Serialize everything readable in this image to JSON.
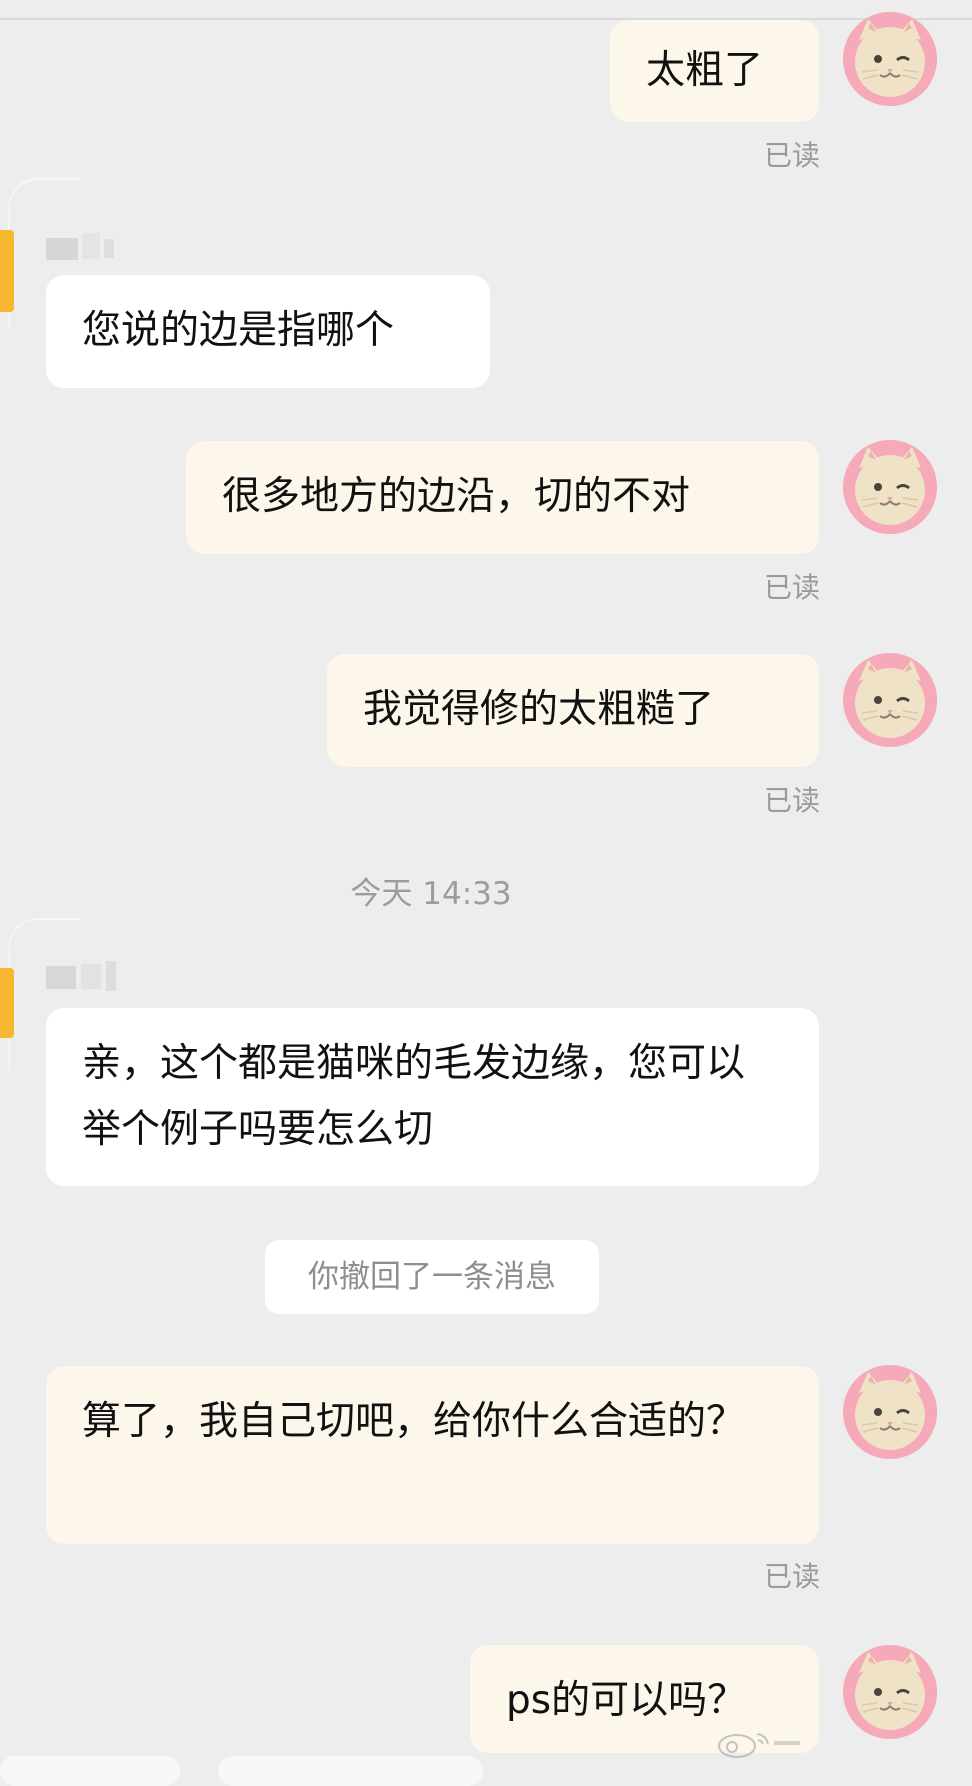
{
  "chat": {
    "messages": [
      {
        "id": "m1",
        "text": "太粗了",
        "status": "已读"
      },
      {
        "id": "m2",
        "text": "您说的边是指哪个"
      },
      {
        "id": "m3",
        "text": "很多地方的边沿，切的不对",
        "status": "已读"
      },
      {
        "id": "m4",
        "text": "我觉得修的太粗糙了",
        "status": "已读"
      },
      {
        "id": "m5",
        "text": "亲，这个都是猫咪的毛发边缘，您可以举个例子吗要怎么切"
      },
      {
        "id": "m6",
        "text": "算了，我自己切吧，给你什么合适的？",
        "status": "已读"
      },
      {
        "id": "m7",
        "text": "ps的可以吗？"
      }
    ],
    "timestamp": "今天 14:33",
    "system_notice": "你撤回了一条消息"
  },
  "colors": {
    "background": "#ededed",
    "outgoing_bubble": "#fcf7ea",
    "incoming_bubble": "#ffffff",
    "avatar_ring": "#f6a9b8",
    "accent_edge": "#f5b72e",
    "read_text": "#9a9a9a"
  },
  "icons": {
    "avatar": "cat-avatar-icon"
  }
}
